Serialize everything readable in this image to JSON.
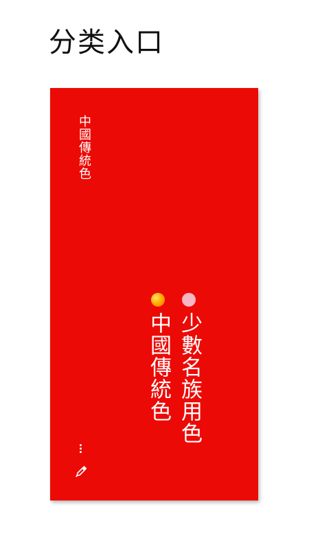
{
  "header": {
    "title": "分类入口"
  },
  "card": {
    "background": "#ec0a06",
    "label": "中國傳統色",
    "entries": [
      {
        "label": "少數名族用色",
        "dot_color": "#f7b6c2"
      },
      {
        "label": "中國傳統色",
        "dot_color": "#ffb000"
      }
    ],
    "icons": {
      "more": "more-vertical-icon",
      "picker": "eyedropper-icon"
    }
  }
}
